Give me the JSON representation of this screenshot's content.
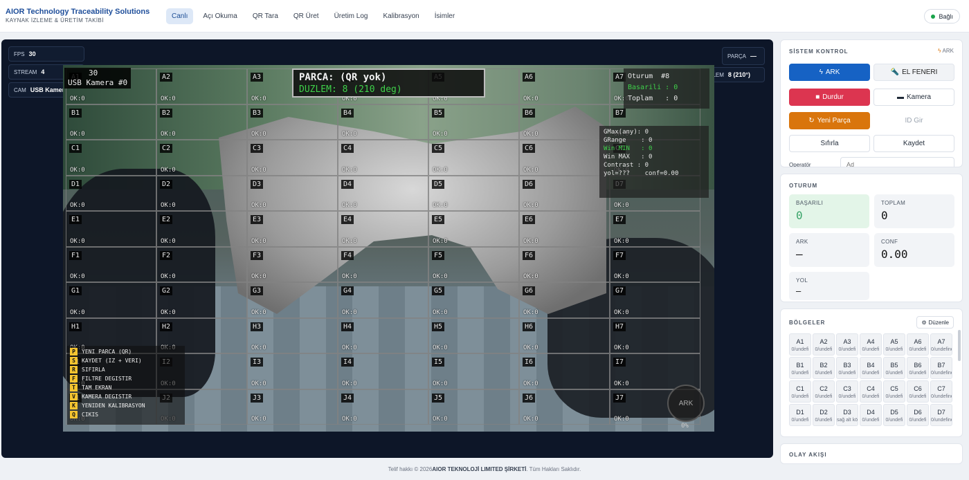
{
  "header": {
    "title": "AIOR Technology Traceability Solutions",
    "subtitle": "KAYNAK İZLEME & ÜRETİM TAKİBİ",
    "nav": [
      "Canlı",
      "Açı Okuma",
      "QR Tara",
      "QR Üret",
      "Üretim Log",
      "Kalibrasyon",
      "İsimler"
    ],
    "active_nav": "Canlı",
    "status": "Bağlı",
    "status_color": "#19a34a"
  },
  "camera": {
    "chips": {
      "fps_label": "FPS",
      "fps_value": "30",
      "stream_label": "STREAM",
      "stream_value": "4",
      "cam_label": "CAM",
      "cam_value": "USB Kamera #0",
      "part_label": "PARÇA",
      "part_value": "—",
      "plane_label": "DÜZLEM",
      "plane_value": "8 (210°)"
    },
    "overlay": {
      "cam_line1": "30",
      "cam_line2": "USB Kamera #0",
      "parca": "PARCA: (QR yok)",
      "duzlem": "DUZLEM: 8  (210 deg)",
      "session": [
        "Oturum  #8",
        "Basarili : 0",
        "Toplam   : 0"
      ],
      "metrics": [
        "GMax(any): 0",
        "GRange    : 0",
        "Win MIN   : 0",
        "Win MAX   : 0",
        "Contrast : 0",
        "yol=???    conf=0.00"
      ],
      "ark_button": "ARK",
      "percent": "0%"
    },
    "grid": {
      "rows": [
        "A",
        "B",
        "C",
        "D",
        "E",
        "F",
        "G",
        "H",
        "I",
        "J"
      ],
      "cols": 7,
      "cell_status": "OK:0"
    },
    "shortcuts": [
      {
        "key": "P",
        "label": "YENI PARCA (QR)"
      },
      {
        "key": "S",
        "label": "KAYDET (IZ + VERI)"
      },
      {
        "key": "R",
        "label": "SIFIRLA"
      },
      {
        "key": "F",
        "label": "FILTRE DEGISTIR"
      },
      {
        "key": "T",
        "label": "TAM EKRAN"
      },
      {
        "key": "V",
        "label": "KAMERA DEGISTIR"
      },
      {
        "key": "K",
        "label": "YENIDEN KALIBRASYON"
      },
      {
        "key": "Q",
        "label": "CIKIS"
      }
    ]
  },
  "system_control": {
    "title": "SİSTEM KONTROL",
    "mode": "ARK",
    "buttons": {
      "ark": "ARK",
      "flashlight": "EL FENERI",
      "stop": "Durdur",
      "camera": "Kamera",
      "new_part": "Yeni Parça",
      "enter_id": "ID Gir",
      "reset": "Sıfırla",
      "save": "Kaydet"
    },
    "operator_label": "Operatör",
    "operator_placeholder": "Ad"
  },
  "session": {
    "title": "OTURUM",
    "success_label": "BAŞARILI",
    "success_value": "0",
    "total_label": "TOPLAM",
    "total_value": "0",
    "ark_label": "ARK",
    "ark_value": "—",
    "conf_label": "CONF",
    "conf_value": "0.00",
    "yol_label": "YOL",
    "yol_value": "–"
  },
  "zones": {
    "title": "BÖLGELER",
    "edit_button": "Düzenle",
    "items": [
      {
        "name": "A1",
        "sub": "0/undefi"
      },
      {
        "name": "A2",
        "sub": "0/undefi"
      },
      {
        "name": "A3",
        "sub": "0/undefi"
      },
      {
        "name": "A4",
        "sub": "0/undefi"
      },
      {
        "name": "A5",
        "sub": "0/undefi"
      },
      {
        "name": "A6",
        "sub": "0/undefi"
      },
      {
        "name": "A7",
        "sub": "0/undefine"
      },
      {
        "name": "B1",
        "sub": "0/undefi"
      },
      {
        "name": "B2",
        "sub": "0/undefi"
      },
      {
        "name": "B3",
        "sub": "0/undefi"
      },
      {
        "name": "B4",
        "sub": "0/undefi"
      },
      {
        "name": "B5",
        "sub": "0/undefi"
      },
      {
        "name": "B6",
        "sub": "0/undefi"
      },
      {
        "name": "B7",
        "sub": "0/undefine"
      },
      {
        "name": "C1",
        "sub": "0/undefi"
      },
      {
        "name": "C2",
        "sub": "0/undefi"
      },
      {
        "name": "C3",
        "sub": "0/undefi"
      },
      {
        "name": "C4",
        "sub": "0/undefi"
      },
      {
        "name": "C5",
        "sub": "0/undefi"
      },
      {
        "name": "C6",
        "sub": "0/undefi"
      },
      {
        "name": "C7",
        "sub": "0/undefine"
      },
      {
        "name": "D1",
        "sub": "0/undefi"
      },
      {
        "name": "D2",
        "sub": "0/undefi"
      },
      {
        "name": "D3",
        "sub": "sağ alt köşe"
      },
      {
        "name": "D4",
        "sub": "0/undefi"
      },
      {
        "name": "D5",
        "sub": "0/undefi"
      },
      {
        "name": "D6",
        "sub": "0/undefi"
      },
      {
        "name": "D7",
        "sub": "0/undefine"
      }
    ]
  },
  "events": {
    "title": "OLAY AKIŞI"
  },
  "footer": {
    "prefix": "Telif hakkı © 2026",
    "company": "AIOR TEKNOLOJİ LIMITED ŞİRKETİ",
    "suffix": ". Tüm Hakları Saklıdır."
  }
}
